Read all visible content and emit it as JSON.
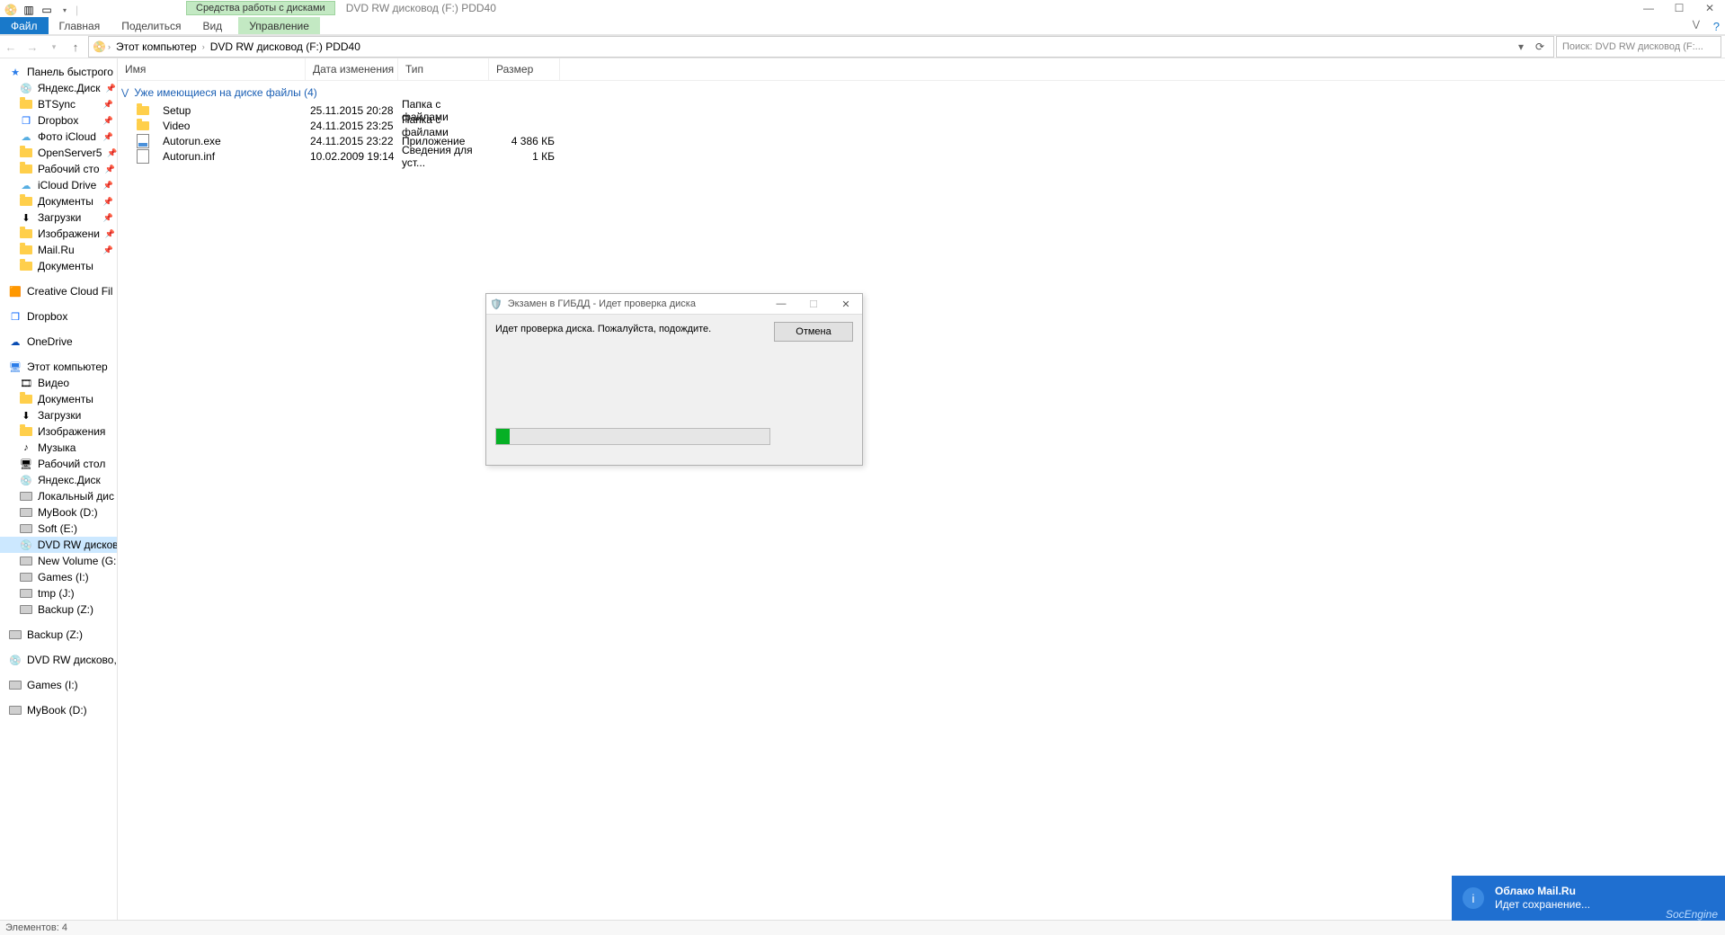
{
  "window": {
    "context_tab": "Средства работы с дисками",
    "title": "DVD RW дисковод (F:) PDD40",
    "ribbon": {
      "file": "Файл",
      "tabs": [
        "Главная",
        "Поделиться",
        "Вид"
      ],
      "ctx": "Управление"
    }
  },
  "address": {
    "crumbs": [
      "Этот компьютер",
      "DVD RW дисковод (F:) PDD40"
    ],
    "search_placeholder": "Поиск: DVD RW дисковод (F:..."
  },
  "columns": {
    "name": "Имя",
    "date": "Дата изменения",
    "type": "Тип",
    "size": "Размер",
    "w_name": 200,
    "w_date": 94,
    "w_type": 92,
    "w_size": 70
  },
  "group": {
    "label": "Уже имеющиеся на диске файлы (4)"
  },
  "files": [
    {
      "icon": "folder",
      "name": "Setup",
      "date": "25.11.2015 20:28",
      "type": "Папка с файлами",
      "size": ""
    },
    {
      "icon": "folder",
      "name": "Video",
      "date": "24.11.2015 23:25",
      "type": "Папка с файлами",
      "size": ""
    },
    {
      "icon": "exe",
      "name": "Autorun.exe",
      "date": "24.11.2015 23:22",
      "type": "Приложение",
      "size": "4 386 КБ"
    },
    {
      "icon": "inf",
      "name": "Autorun.inf",
      "date": "10.02.2009 19:14",
      "type": "Сведения для уст...",
      "size": "1 КБ"
    }
  ],
  "nav": {
    "quick": {
      "label": "Панель быстрого",
      "items": [
        {
          "ico": "disc",
          "label": "Яндекс.Диск",
          "pin": true
        },
        {
          "ico": "folder",
          "label": "BTSync",
          "pin": true
        },
        {
          "ico": "clouddb",
          "label": "Dropbox",
          "pin": true
        },
        {
          "ico": "cloud-ico",
          "label": "Фото iCloud",
          "pin": true
        },
        {
          "ico": "folder",
          "label": "OpenServer5",
          "pin": true
        },
        {
          "ico": "folder",
          "label": "Рабочий сто",
          "pin": true
        },
        {
          "ico": "cloud-ico",
          "label": "iCloud Drive",
          "pin": true
        },
        {
          "ico": "folder",
          "label": "Документы",
          "pin": true
        },
        {
          "ico": "down",
          "label": "Загрузки",
          "pin": true
        },
        {
          "ico": "folder",
          "label": "Изображени",
          "pin": true
        },
        {
          "ico": "folder",
          "label": "Mail.Ru",
          "pin": true
        },
        {
          "ico": "folder",
          "label": "Документы",
          "pin": false
        }
      ]
    },
    "roots": [
      {
        "ico": "cc",
        "label": "Creative Cloud Fil"
      },
      {
        "ico": "clouddb",
        "label": "Dropbox"
      },
      {
        "ico": "cloudon",
        "label": "OneDrive"
      }
    ],
    "thispc": {
      "label": "Этот компьютер",
      "items": [
        {
          "ico": "video",
          "label": "Видео"
        },
        {
          "ico": "folder",
          "label": "Документы"
        },
        {
          "ico": "down",
          "label": "Загрузки"
        },
        {
          "ico": "folder",
          "label": "Изображения"
        },
        {
          "ico": "music",
          "label": "Музыка"
        },
        {
          "ico": "desk",
          "label": "Рабочий стол"
        },
        {
          "ico": "disc",
          "label": "Яндекс.Диск"
        },
        {
          "ico": "drive",
          "label": "Локальный дис"
        },
        {
          "ico": "drive",
          "label": "MyBook (D:)"
        },
        {
          "ico": "drive",
          "label": "Soft (E:)"
        },
        {
          "ico": "dvd",
          "label": "DVD RW дисков",
          "selected": true
        },
        {
          "ico": "drive",
          "label": "New Volume (G:"
        },
        {
          "ico": "drive",
          "label": "Games (I:)"
        },
        {
          "ico": "drive",
          "label": "tmp (J:)"
        },
        {
          "ico": "drive",
          "label": "Backup (Z:)"
        }
      ]
    },
    "extra": [
      {
        "ico": "drive",
        "label": "Backup (Z:)"
      },
      {
        "ico": "dvd",
        "label": "DVD RW дисково,"
      },
      {
        "ico": "drive",
        "label": "Games (I:)"
      },
      {
        "ico": "drive",
        "label": "MyBook (D:)"
      }
    ]
  },
  "status": {
    "text": "Элементов: 4"
  },
  "dialog": {
    "title": "Экзамен в ГИБДД - Идет проверка диска",
    "message": "Идет проверка диска. Пожалуйста, подождите.",
    "cancel": "Отмена",
    "progress_pct": 5
  },
  "toast": {
    "title": "Облако Mail.Ru",
    "body": "Идет сохранение...",
    "brand": "SocEngine"
  }
}
